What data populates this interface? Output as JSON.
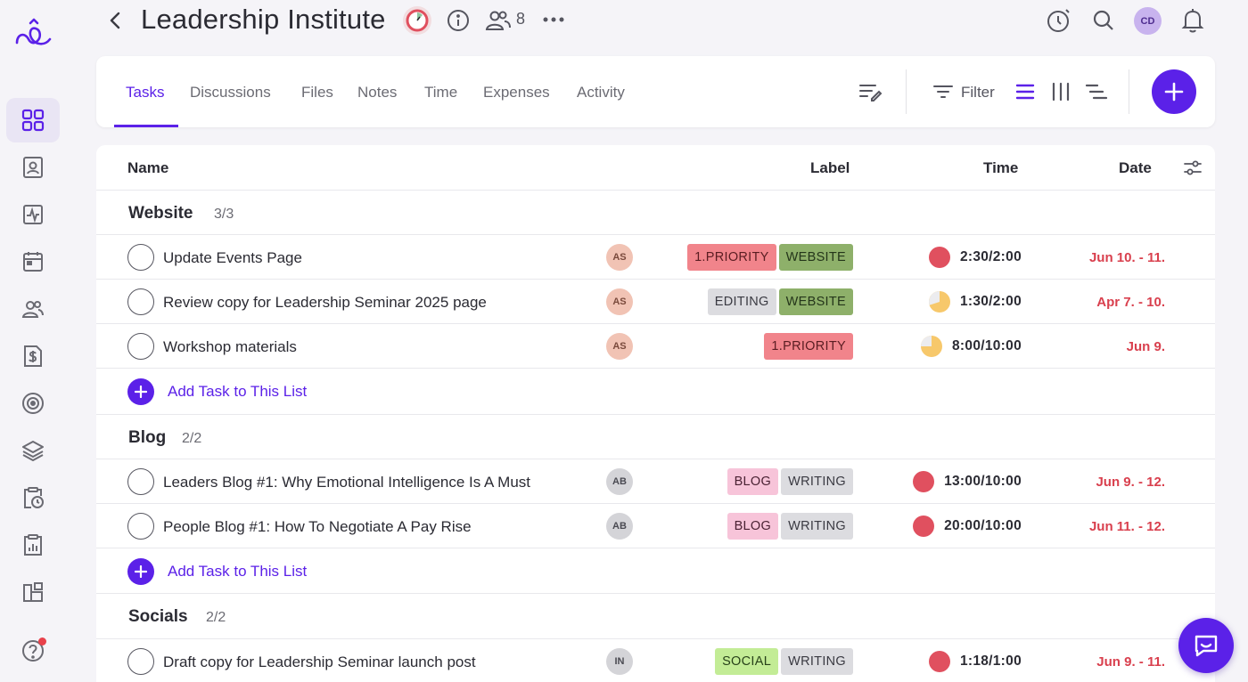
{
  "header": {
    "title": "Leadership Institute",
    "member_count": "8",
    "user_initials": "CD"
  },
  "tabs": [
    {
      "label": "Tasks",
      "active": true
    },
    {
      "label": "Discussions"
    },
    {
      "label": "Files"
    },
    {
      "label": "Notes"
    },
    {
      "label": "Time"
    },
    {
      "label": "Expenses"
    },
    {
      "label": "Activity"
    }
  ],
  "toolbar": {
    "filter_label": "Filter"
  },
  "table": {
    "columns": {
      "name": "Name",
      "label": "Label",
      "time": "Time",
      "date": "Date"
    },
    "add_task_label": "Add Task to This List",
    "groups": [
      {
        "title": "Website",
        "count": "3/3",
        "tasks": [
          {
            "name": "Update Events Page",
            "assignee": "AS",
            "labels": [
              "1.PRIORITY",
              "WEBSITE"
            ],
            "time": "2:30/2:00",
            "date": "Jun 10. - 11."
          },
          {
            "name": "Review copy for Leadership Seminar 2025 page",
            "assignee": "AS",
            "labels": [
              "EDITING",
              "WEBSITE"
            ],
            "time": "1:30/2:00",
            "date": "Apr 7. - 10."
          },
          {
            "name": "Workshop materials",
            "assignee": "AS",
            "labels": [
              "1.PRIORITY"
            ],
            "time": "8:00/10:00",
            "date": "Jun 9."
          }
        ]
      },
      {
        "title": "Blog",
        "count": "2/2",
        "tasks": [
          {
            "name": "Leaders Blog #1: Why Emotional Intelligence Is A Must",
            "assignee": "AB",
            "labels": [
              "BLOG",
              "WRITING"
            ],
            "time": "13:00/10:00",
            "date": "Jun 9. - 12."
          },
          {
            "name": "People Blog #1: How To Negotiate A Pay Rise",
            "assignee": "AB",
            "labels": [
              "BLOG",
              "WRITING"
            ],
            "time": "20:00/10:00",
            "date": "Jun 11. - 12."
          }
        ]
      },
      {
        "title": "Socials",
        "count": "2/2",
        "tasks": [
          {
            "name": "Draft copy for Leadership Seminar launch post",
            "assignee": "IN",
            "labels": [
              "SOCIAL",
              "WRITING"
            ],
            "time": "1:18/1:00",
            "date": "Jun 9. - 11."
          }
        ]
      }
    ]
  },
  "colors": {
    "accent": "#5b21e8",
    "overdue_red": "#d9404e",
    "timer_red": "#e0505f",
    "timer_partial": "#f7c86b"
  }
}
